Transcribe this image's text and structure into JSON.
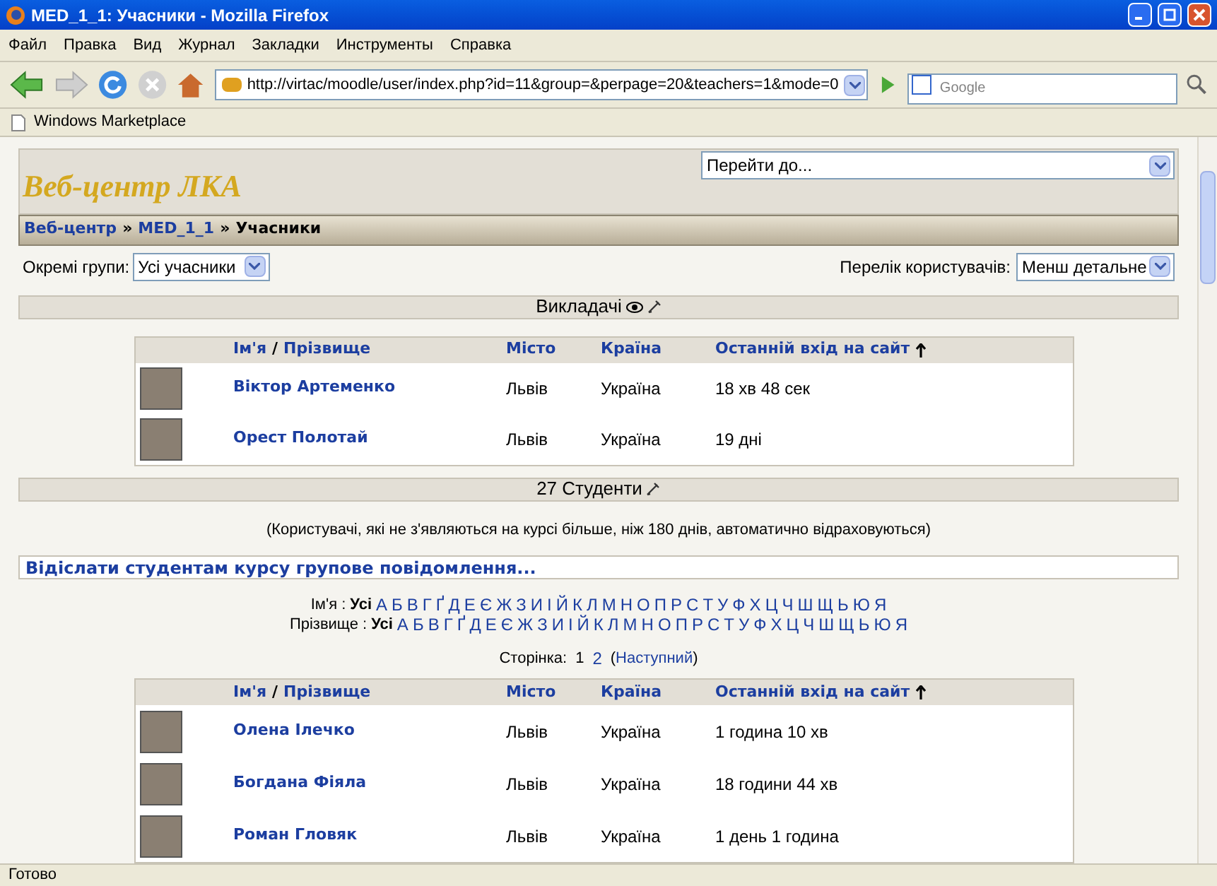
{
  "window": {
    "title": "MED_1_1: Учасники - Mozilla Firefox"
  },
  "menu": [
    "Файл",
    "Правка",
    "Вид",
    "Журнал",
    "Закладки",
    "Инструменты",
    "Справка"
  ],
  "address": {
    "value": "http://virtac/moodle/user/index.php?id=11&group=&perpage=20&teachers=1&mode=0"
  },
  "search": {
    "placeholder": "Google"
  },
  "bookmarks": [
    "Windows Marketplace"
  ],
  "site": {
    "title": "Веб-центр ЛКА",
    "jump": "Перейти до..."
  },
  "breadcrumb": [
    {
      "text": "Веб-центр",
      "link": true
    },
    {
      "text": "MED_1_1",
      "link": true
    },
    {
      "text": "Учасники",
      "link": false
    }
  ],
  "breadcrumb_separator": "»",
  "groups": {
    "label": "Окремі групи:",
    "value": "Усі учасники"
  },
  "list_mode": {
    "label": "Перелік користувачів:",
    "value": "Менш детальне"
  },
  "teachers": {
    "heading": "Викладачі",
    "columns": [
      {
        "text": "Ім'я"
      },
      {
        "text": "/"
      },
      {
        "text": "Прізвище"
      },
      {
        "text": "Місто"
      },
      {
        "text": "Країна"
      },
      {
        "text": "Останній вхід на сайт"
      }
    ],
    "rows": [
      {
        "name": "Віктор Артеменко",
        "city": "Львів",
        "country": "Україна",
        "last": "18 хв 48 сек"
      },
      {
        "name": "Орест Полотай",
        "city": "Львів",
        "country": "Україна",
        "last": "19 дні"
      }
    ]
  },
  "students": {
    "heading": "27 Студенти",
    "note": "(Користувачі, які не з'являються на курсі більше, ніж 180 днів, автоматично відраховуються)",
    "message_link": "Відіслати студентам курсу групове повідомлення...",
    "filters": [
      {
        "label": "Ім'я :",
        "items": [
          {
            "text": "Усі",
            "selected": true
          },
          {
            "text": "А",
            "selected": false
          },
          {
            "text": "Б",
            "selected": false
          },
          {
            "text": "В",
            "selected": false
          },
          {
            "text": "Г",
            "selected": false
          },
          {
            "text": "Ґ",
            "selected": false
          },
          {
            "text": "Д",
            "selected": false
          },
          {
            "text": "Е",
            "selected": false
          },
          {
            "text": "Є",
            "selected": false
          },
          {
            "text": "Ж",
            "selected": false
          },
          {
            "text": "З",
            "selected": false
          },
          {
            "text": "И",
            "selected": false
          },
          {
            "text": "І",
            "selected": false
          },
          {
            "text": "Й",
            "selected": false
          },
          {
            "text": "К",
            "selected": false
          },
          {
            "text": "Л",
            "selected": false
          },
          {
            "text": "М",
            "selected": false
          },
          {
            "text": "Н",
            "selected": false
          },
          {
            "text": "О",
            "selected": false
          },
          {
            "text": "П",
            "selected": false
          },
          {
            "text": "Р",
            "selected": false
          },
          {
            "text": "С",
            "selected": false
          },
          {
            "text": "Т",
            "selected": false
          },
          {
            "text": "У",
            "selected": false
          },
          {
            "text": "Ф",
            "selected": false
          },
          {
            "text": "Х",
            "selected": false
          },
          {
            "text": "Ц",
            "selected": false
          },
          {
            "text": "Ч",
            "selected": false
          },
          {
            "text": "Ш",
            "selected": false
          },
          {
            "text": "Щ",
            "selected": false
          },
          {
            "text": "Ь",
            "selected": false
          },
          {
            "text": "Ю",
            "selected": false
          },
          {
            "text": "Я",
            "selected": false
          }
        ]
      },
      {
        "label": "Прізвище :",
        "items": [
          {
            "text": "Усі",
            "selected": true
          },
          {
            "text": "А",
            "selected": false
          },
          {
            "text": "Б",
            "selected": false
          },
          {
            "text": "В",
            "selected": false
          },
          {
            "text": "Г",
            "selected": false
          },
          {
            "text": "Ґ",
            "selected": false
          },
          {
            "text": "Д",
            "selected": false
          },
          {
            "text": "Е",
            "selected": false
          },
          {
            "text": "Є",
            "selected": false
          },
          {
            "text": "Ж",
            "selected": false
          },
          {
            "text": "З",
            "selected": false
          },
          {
            "text": "И",
            "selected": false
          },
          {
            "text": "І",
            "selected": false
          },
          {
            "text": "Й",
            "selected": false
          },
          {
            "text": "К",
            "selected": false
          },
          {
            "text": "Л",
            "selected": false
          },
          {
            "text": "М",
            "selected": false
          },
          {
            "text": "Н",
            "selected": false
          },
          {
            "text": "О",
            "selected": false
          },
          {
            "text": "П",
            "selected": false
          },
          {
            "text": "Р",
            "selected": false
          },
          {
            "text": "С",
            "selected": false
          },
          {
            "text": "Т",
            "selected": false
          },
          {
            "text": "У",
            "selected": false
          },
          {
            "text": "Ф",
            "selected": false
          },
          {
            "text": "Х",
            "selected": false
          },
          {
            "text": "Ц",
            "selected": false
          },
          {
            "text": "Ч",
            "selected": false
          },
          {
            "text": "Ш",
            "selected": false
          },
          {
            "text": "Щ",
            "selected": false
          },
          {
            "text": "Ь",
            "selected": false
          },
          {
            "text": "Ю",
            "selected": false
          },
          {
            "text": "Я",
            "selected": false
          }
        ]
      }
    ],
    "pager": {
      "label": "Сторінка:",
      "pages": [
        {
          "text": "1",
          "selected": true
        },
        {
          "text": "2",
          "selected": false
        }
      ],
      "open": "(",
      "next": "Наступний",
      "close": ")"
    },
    "columns": [
      {
        "text": "Ім'я"
      },
      {
        "text": "/"
      },
      {
        "text": "Прізвище"
      },
      {
        "text": "Місто"
      },
      {
        "text": "Країна"
      },
      {
        "text": "Останній вхід на сайт"
      }
    ],
    "rows": [
      {
        "name": "Олена Ілечко",
        "city": "Львів",
        "country": "Україна",
        "last": "1 година 10 хв"
      },
      {
        "name": "Богдана Фіяла",
        "city": "Львів",
        "country": "Україна",
        "last": "18 години 44 хв"
      },
      {
        "name": "Роман Гловяк",
        "city": "Львів",
        "country": "Україна",
        "last": "1 день 1 година"
      }
    ]
  },
  "status_bar": "Готово"
}
